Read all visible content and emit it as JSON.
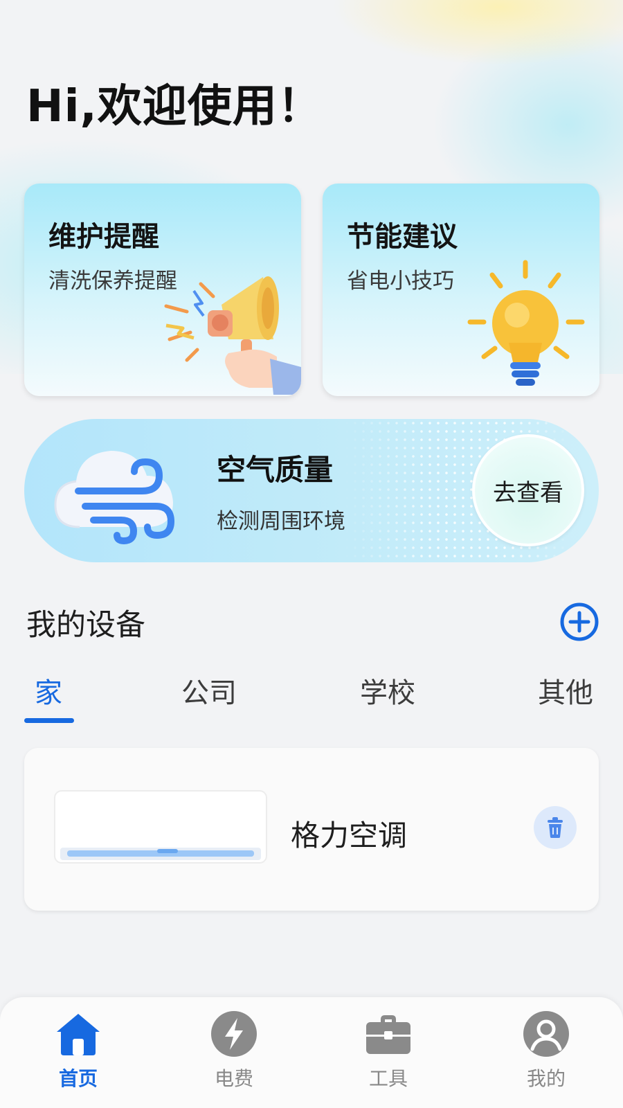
{
  "greeting": "Hi,欢迎使用！",
  "cards": {
    "maintenance": {
      "title": "维护提醒",
      "subtitle": "清洗保养提醒",
      "icon": "megaphone-icon"
    },
    "energy": {
      "title": "节能建议",
      "subtitle": "省电小技巧",
      "icon": "lightbulb-icon"
    }
  },
  "air_quality": {
    "title": "空气质量",
    "subtitle": "检测周围环境",
    "button": "去查看",
    "icon": "wind-cloud-icon"
  },
  "devices": {
    "section_title": "我的设备",
    "add_icon": "plus-circle-icon",
    "tabs": [
      {
        "label": "家",
        "active": true
      },
      {
        "label": "公司",
        "active": false
      },
      {
        "label": "学校",
        "active": false
      },
      {
        "label": "其他",
        "active": false
      }
    ],
    "items": [
      {
        "name": "格力空调",
        "icon": "air-conditioner-icon",
        "delete_icon": "trash-icon"
      }
    ]
  },
  "bottom_nav": [
    {
      "label": "首页",
      "icon": "home-icon",
      "active": true
    },
    {
      "label": "电费",
      "icon": "lightning-icon",
      "active": false
    },
    {
      "label": "工具",
      "icon": "toolbox-icon",
      "active": false
    },
    {
      "label": "我的",
      "icon": "user-icon",
      "active": false
    }
  ],
  "colors": {
    "accent": "#1769e0",
    "card_top": "#a8e9f9",
    "inactive": "#888888"
  }
}
